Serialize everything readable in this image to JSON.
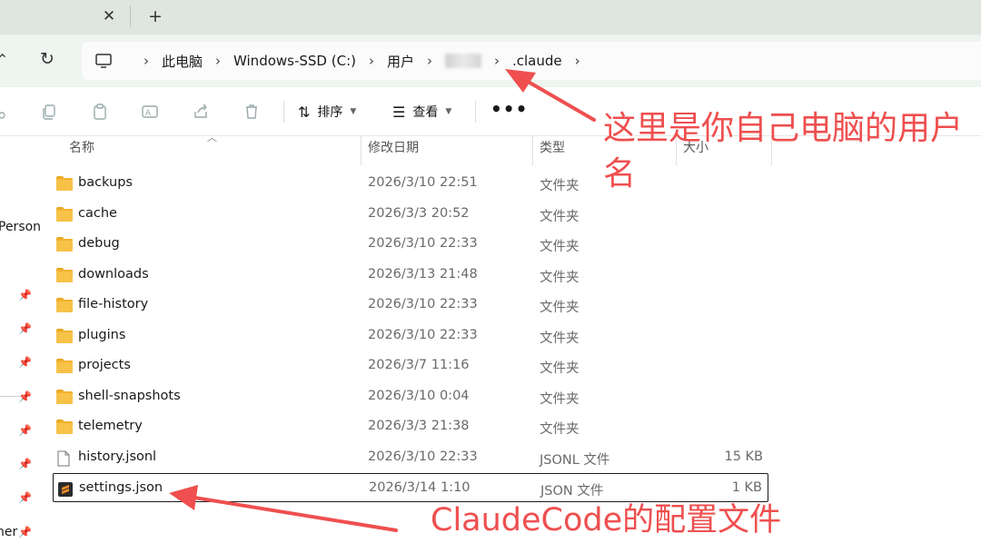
{
  "tabs": {
    "close_glyph": "✕",
    "new_glyph": "+"
  },
  "address": {
    "crumbs": [
      "此电脑",
      "Windows-SSD (C:)",
      "用户",
      ".claude"
    ],
    "separator": "›"
  },
  "toolbar": {
    "sort_label": "排序",
    "view_label": "查看",
    "more_label": "•••",
    "icons": [
      "cut-icon",
      "copy-icon",
      "paste-icon",
      "rename-icon",
      "share-icon",
      "delete-icon",
      "sort-icon",
      "view-icon"
    ]
  },
  "sidebar": {
    "items": [
      "Person",
      "her"
    ]
  },
  "columns": {
    "name": "名称",
    "date": "修改日期",
    "type": "类型",
    "size": "大小"
  },
  "files": [
    {
      "name": "backups",
      "date": "2026/3/10 22:51",
      "type": "文件夹",
      "size": "",
      "kind": "folder"
    },
    {
      "name": "cache",
      "date": "2026/3/3 20:52",
      "type": "文件夹",
      "size": "",
      "kind": "folder"
    },
    {
      "name": "debug",
      "date": "2026/3/10 22:33",
      "type": "文件夹",
      "size": "",
      "kind": "folder"
    },
    {
      "name": "downloads",
      "date": "2026/3/13 21:48",
      "type": "文件夹",
      "size": "",
      "kind": "folder"
    },
    {
      "name": "file-history",
      "date": "2026/3/10 22:33",
      "type": "文件夹",
      "size": "",
      "kind": "folder"
    },
    {
      "name": "plugins",
      "date": "2026/3/10 22:33",
      "type": "文件夹",
      "size": "",
      "kind": "folder"
    },
    {
      "name": "projects",
      "date": "2026/3/7 11:16",
      "type": "文件夹",
      "size": "",
      "kind": "folder"
    },
    {
      "name": "shell-snapshots",
      "date": "2026/3/10 0:04",
      "type": "文件夹",
      "size": "",
      "kind": "folder"
    },
    {
      "name": "telemetry",
      "date": "2026/3/3 21:38",
      "type": "文件夹",
      "size": "",
      "kind": "folder"
    },
    {
      "name": "history.jsonl",
      "date": "2026/3/10 22:33",
      "type": "JSONL 文件",
      "size": "15 KB",
      "kind": "file"
    },
    {
      "name": "settings.json",
      "date": "2026/3/14 1:10",
      "type": "JSON 文件",
      "size": "1 KB",
      "kind": "json",
      "selected": true
    }
  ],
  "annotations": {
    "username_note": "这里是你自己电脑的用户",
    "username_note_cont": "名",
    "config_note": "ClaudeCode的配置文件",
    "color": "#ef4f4f"
  },
  "colors": {
    "folder": "#f7c248",
    "json_icon": "#f08a24",
    "tabstrip": "#dfe6e0",
    "address_row": "#eef4ef"
  }
}
